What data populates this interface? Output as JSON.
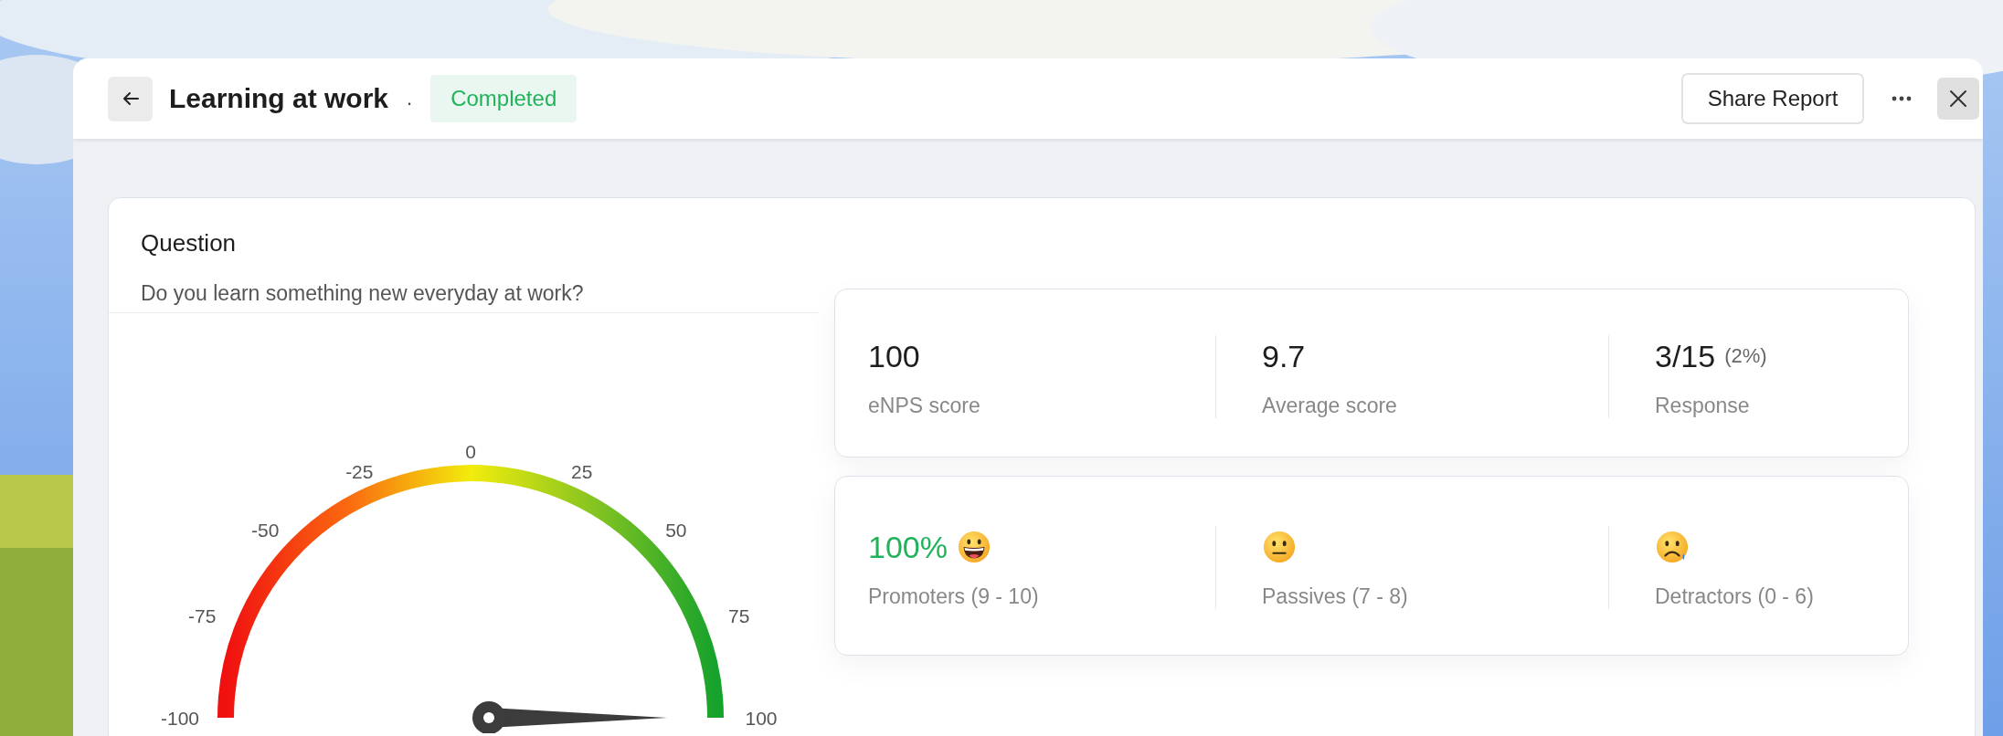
{
  "header": {
    "title": "Learning at work",
    "separator": ".",
    "status": "Completed",
    "share_button": "Share Report"
  },
  "question": {
    "heading": "Question",
    "text": "Do you learn something new everyday at work?"
  },
  "gauge": {
    "ticks": [
      "-100",
      "-75",
      "-50",
      "-25",
      "0",
      "25",
      "50",
      "75",
      "100"
    ],
    "level": 1
  },
  "summary": [
    {
      "value": "100",
      "label": "eNPS score"
    },
    {
      "value": "9.7",
      "label": "Average score"
    },
    {
      "value": "3/15",
      "note": "(2%)",
      "label": "Response"
    }
  ],
  "groups": [
    {
      "value": "100%",
      "kind": "grinning",
      "label": "Promoters (9 - 10)"
    },
    {
      "kind": "neutral",
      "label": "Passives (7 - 8)"
    },
    {
      "kind": "sad",
      "label": "Detractors (0 - 6)"
    }
  ]
}
